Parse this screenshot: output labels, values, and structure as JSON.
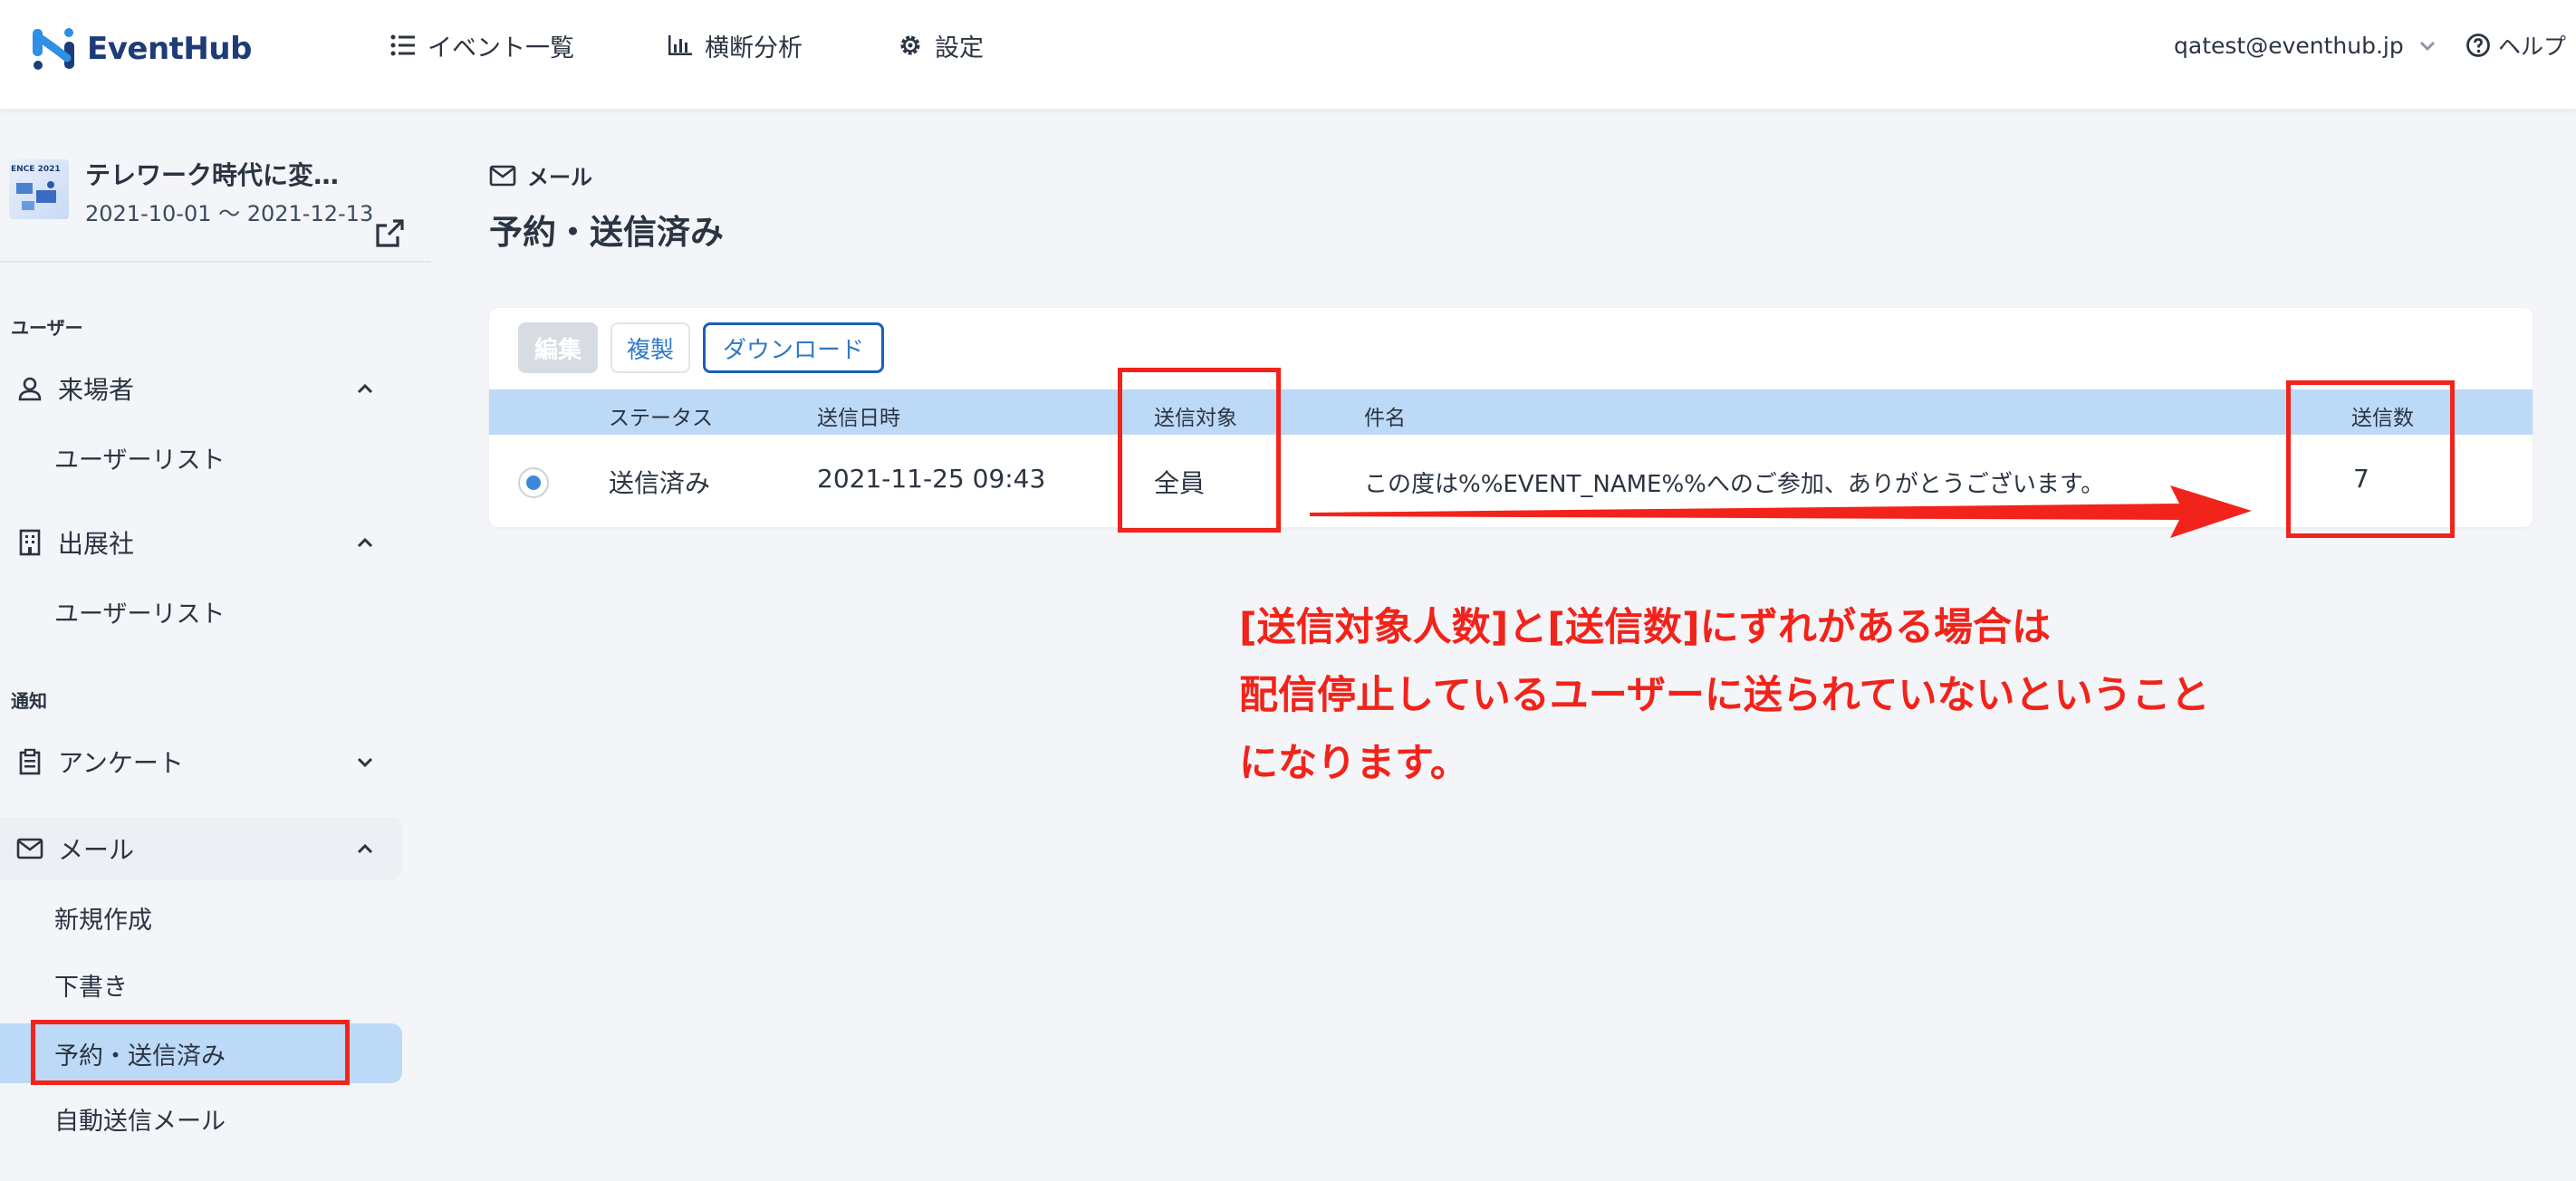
{
  "app": {
    "name": "EventHub",
    "brand_color": "#1d3c78",
    "accent_color": "#2f79c9"
  },
  "header": {
    "nav": [
      {
        "label": "イベント一覧",
        "icon": "list-icon"
      },
      {
        "label": "横断分析",
        "icon": "bar-chart-icon"
      },
      {
        "label": "設定",
        "icon": "gear-icon"
      }
    ],
    "user_email": "qatest@eventhub.jp",
    "help_label": "ヘルプ"
  },
  "event": {
    "title": "テレワーク時代に変…",
    "thumbnail_text": "ENCE 2021",
    "dates": "2021-10-01 〜 2021-12-13"
  },
  "sidebar": {
    "sections": [
      {
        "label": "ユーザー"
      },
      {
        "label": "通知"
      }
    ],
    "groups": {
      "visitors": {
        "label": "来場者",
        "sub": "ユーザーリスト"
      },
      "exhibitors": {
        "label": "出展社",
        "sub": "ユーザーリスト"
      },
      "survey": {
        "label": "アンケート"
      },
      "mail": {
        "label": "メール",
        "items": [
          "新規作成",
          "下書き",
          "予約・送信済み",
          "自動送信メール"
        ]
      }
    }
  },
  "main": {
    "breadcrumb": "メール",
    "title": "予約・送信済み",
    "buttons": {
      "edit": "編集",
      "copy": "複製",
      "download": "ダウンロード"
    },
    "table": {
      "columns": [
        "ステータス",
        "送信日時",
        "送信対象",
        "件名",
        "送信数"
      ],
      "rows": [
        {
          "status": "送信済み",
          "sent_at": "2021-11-25 09:43",
          "target": "全員",
          "subject": "この度は%%EVENT_NAME%%へのご参加、ありがとうございます。",
          "count": "7"
        }
      ]
    }
  },
  "annotation": {
    "color": "#f2231a",
    "lines": [
      "[送信対象人数]と[送信数]にずれがある場合は",
      "配信停止しているユーザーに送られていないということ",
      "になります。"
    ]
  }
}
